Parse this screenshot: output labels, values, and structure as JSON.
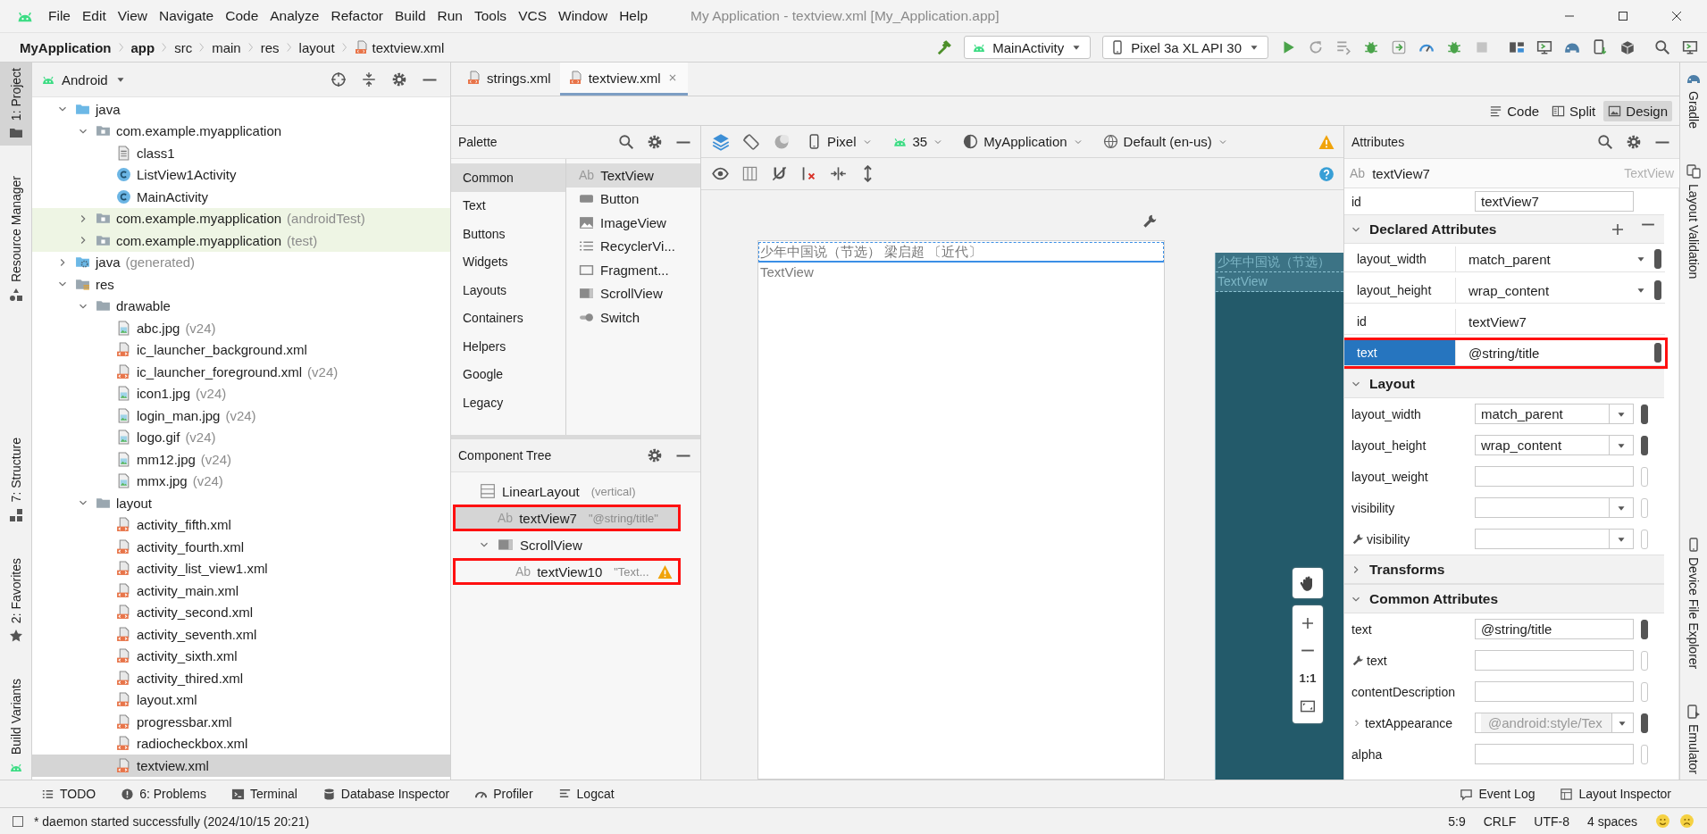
{
  "menu_bar": {
    "menus": [
      "File",
      "Edit",
      "View",
      "Navigate",
      "Code",
      "Analyze",
      "Refactor",
      "Build",
      "Run",
      "Tools",
      "VCS",
      "Window",
      "Help"
    ],
    "title": "My Application - textview.xml [My_Application.app]"
  },
  "breadcrumb": [
    {
      "label": "MyApplication",
      "kind": "module"
    },
    {
      "label": "app",
      "kind": "module"
    },
    {
      "label": "src",
      "kind": "folder"
    },
    {
      "label": "main",
      "kind": "folder"
    },
    {
      "label": "res",
      "kind": "folder"
    },
    {
      "label": "layout",
      "kind": "folder"
    },
    {
      "label": "textview.xml",
      "kind": "file"
    }
  ],
  "run_toolbar": {
    "configuration": "MainActivity",
    "device": "Pixel 3a XL API 30"
  },
  "left_strip": {
    "top": [
      {
        "label": "1: Project",
        "kind": "project",
        "selected": true
      },
      {
        "label": "Resource Manager",
        "kind": "resources",
        "selected": false
      }
    ],
    "bottom": [
      {
        "label": "7: Structure",
        "kind": "structure",
        "selected": false
      },
      {
        "label": "2: Favorites",
        "kind": "favorites",
        "selected": false
      },
      {
        "label": "Build Variants",
        "kind": "variants",
        "selected": false
      }
    ]
  },
  "project_panel": {
    "view": "Android",
    "tree": [
      {
        "label": "java",
        "kind": "source-folder",
        "expanded": true,
        "selected": false,
        "children": [
          {
            "label": "com.example.myapplication",
            "kind": "package",
            "expanded": true,
            "selected": false,
            "children": [
              {
                "label": "class1",
                "kind": "text-file",
                "selected": false
              },
              {
                "label": "ListView1Activity",
                "kind": "class",
                "selected": false
              },
              {
                "label": "MainActivity",
                "kind": "class",
                "selected": false
              }
            ]
          },
          {
            "label": "com.example.myapplication",
            "note": "(androidTest)",
            "kind": "test-package",
            "expanded": false,
            "selected": false
          },
          {
            "label": "com.example.myapplication",
            "note": "(test)",
            "kind": "test-package",
            "expanded": false,
            "selected": false
          }
        ]
      },
      {
        "label": "java",
        "note": "(generated)",
        "kind": "generated-folder",
        "expanded": false,
        "selected": false
      },
      {
        "label": "res",
        "kind": "res-folder",
        "expanded": true,
        "selected": false,
        "children": [
          {
            "label": "drawable",
            "kind": "folder",
            "expanded": true,
            "selected": false,
            "children": [
              {
                "label": "abc.jpg",
                "note": "(v24)",
                "kind": "image-file",
                "selected": false
              },
              {
                "label": "ic_launcher_background.xml",
                "kind": "xml-file",
                "selected": false
              },
              {
                "label": "ic_launcher_foreground.xml",
                "note": "(v24)",
                "kind": "xml-file",
                "selected": false
              },
              {
                "label": "icon1.jpg",
                "note": "(v24)",
                "kind": "image-file",
                "selected": false
              },
              {
                "label": "login_man.jpg",
                "note": "(v24)",
                "kind": "image-file",
                "selected": false
              },
              {
                "label": "logo.gif",
                "note": "(v24)",
                "kind": "image-file",
                "selected": false
              },
              {
                "label": "mm12.jpg",
                "note": "(v24)",
                "kind": "image-file",
                "selected": false
              },
              {
                "label": "mmx.jpg",
                "note": "(v24)",
                "kind": "image-file",
                "selected": false
              }
            ]
          },
          {
            "label": "layout",
            "kind": "folder",
            "expanded": true,
            "selected": false,
            "children": [
              {
                "label": "activity_fifth.xml",
                "kind": "xml-file",
                "selected": false
              },
              {
                "label": "activity_fourth.xml",
                "kind": "xml-file",
                "selected": false
              },
              {
                "label": "activity_list_view1.xml",
                "kind": "xml-file",
                "selected": false
              },
              {
                "label": "activity_main.xml",
                "kind": "xml-file",
                "selected": false
              },
              {
                "label": "activity_second.xml",
                "kind": "xml-file",
                "selected": false
              },
              {
                "label": "activity_seventh.xml",
                "kind": "xml-file",
                "selected": false
              },
              {
                "label": "activity_sixth.xml",
                "kind": "xml-file",
                "selected": false
              },
              {
                "label": "activity_thired.xml",
                "kind": "xml-file",
                "selected": false
              },
              {
                "label": "layout.xml",
                "kind": "xml-file",
                "selected": false
              },
              {
                "label": "progressbar.xml",
                "kind": "xml-file",
                "selected": false
              },
              {
                "label": "radiocheckbox.xml",
                "kind": "xml-file",
                "selected": false
              },
              {
                "label": "textview.xml",
                "kind": "xml-file",
                "selected": true
              }
            ]
          }
        ]
      }
    ]
  },
  "editor_tabs": [
    {
      "label": "strings.xml",
      "selected": false
    },
    {
      "label": "textview.xml",
      "selected": true
    }
  ],
  "view_modes": [
    {
      "label": "Code",
      "kind": "code",
      "selected": false
    },
    {
      "label": "Split",
      "kind": "split",
      "selected": false
    },
    {
      "label": "Design",
      "kind": "design",
      "selected": true
    }
  ],
  "palette": {
    "title": "Palette",
    "categories": [
      {
        "label": "Common",
        "selected": true
      },
      {
        "label": "Text",
        "selected": false
      },
      {
        "label": "Buttons",
        "selected": false
      },
      {
        "label": "Widgets",
        "selected": false
      },
      {
        "label": "Layouts",
        "selected": false
      },
      {
        "label": "Containers",
        "selected": false
      },
      {
        "label": "Helpers",
        "selected": false
      },
      {
        "label": "Google",
        "selected": false
      },
      {
        "label": "Legacy",
        "selected": false
      }
    ],
    "items": [
      {
        "label": "TextView",
        "kind": "textview",
        "badge": "Ab",
        "selected": true
      },
      {
        "label": "Button",
        "kind": "button",
        "selected": false
      },
      {
        "label": "ImageView",
        "kind": "imageview",
        "selected": false
      },
      {
        "label": "RecyclerVi...",
        "kind": "recycler",
        "selected": false
      },
      {
        "label": "Fragment...",
        "kind": "fragment",
        "selected": false
      },
      {
        "label": "ScrollView",
        "kind": "scrollview",
        "selected": false
      },
      {
        "label": "Switch",
        "kind": "switch",
        "selected": false
      }
    ]
  },
  "component_tree": {
    "title": "Component Tree",
    "tree": [
      {
        "name": "LinearLayout",
        "detail": "(vertical)",
        "kind": "linear",
        "selected": false,
        "children": [
          {
            "name": "textView7",
            "badge": "Ab",
            "detail": "\"@string/title\"",
            "kind": "textview",
            "selected": true,
            "annotated": true
          },
          {
            "name": "ScrollView",
            "kind": "scrollview",
            "expanded": true,
            "selected": false,
            "children": [
              {
                "name": "textView10",
                "badge": "Ab",
                "detail": "\"Text...",
                "kind": "textview",
                "warning": true,
                "selected": false,
                "annotated": true
              }
            ]
          }
        ]
      }
    ]
  },
  "design_toolbar": {
    "device": "Pixel",
    "api": "35",
    "theme": "MyApplication",
    "locale": "Default (en-us)"
  },
  "canvas": {
    "design_texts": [
      {
        "text": "少年中国说（节选） 梁启超 〔近代〕",
        "selected": true
      },
      {
        "text": "TextView",
        "selected": false
      }
    ],
    "blueprint_texts": [
      "少年中国说（节选）",
      "TextView"
    ],
    "zoom_label": "1:1"
  },
  "attributes": {
    "title": "Attributes",
    "component": {
      "badge": "Ab",
      "name": "textView7",
      "type": "TextView"
    },
    "id_row": {
      "name": "id",
      "value": "textView7"
    },
    "sections": [
      {
        "title": "Declared Attributes",
        "kind": "declared",
        "expanded": true,
        "rows": [
          {
            "name": "layout_width",
            "value": "match_parent",
            "kind": "dropdown",
            "selected": false
          },
          {
            "name": "layout_height",
            "value": "wrap_content",
            "kind": "dropdown",
            "selected": false
          },
          {
            "name": "id",
            "value": "textView7",
            "kind": "plain",
            "selected": false
          },
          {
            "name": "text",
            "value": "@string/title",
            "kind": "plain",
            "selected": true,
            "annotated": true
          }
        ]
      },
      {
        "title": "Layout",
        "kind": "form",
        "expanded": true,
        "rows": [
          {
            "name": "layout_width",
            "value": "match_parent",
            "kind": "dropdown"
          },
          {
            "name": "layout_height",
            "value": "wrap_content",
            "kind": "dropdown"
          },
          {
            "name": "layout_weight",
            "kind": "field"
          },
          {
            "name": "visibility",
            "kind": "dropdown"
          },
          {
            "name": "visibility",
            "kind": "dropdown",
            "tools": true
          }
        ]
      },
      {
        "title": "Transforms",
        "kind": "form",
        "expanded": false
      },
      {
        "title": "Common Attributes",
        "kind": "form",
        "expanded": true,
        "rows": [
          {
            "name": "text",
            "value": "@string/title",
            "kind": "field"
          },
          {
            "name": "text",
            "kind": "field",
            "tools": true
          },
          {
            "name": "contentDescription",
            "kind": "field"
          },
          {
            "name": "textAppearance",
            "placeholder": "@android:style/Tex",
            "kind": "dropdown",
            "expanded": false
          },
          {
            "name": "alpha",
            "kind": "field"
          }
        ]
      }
    ]
  },
  "right_strip": {
    "top": [
      {
        "label": "Gradle",
        "kind": "gradle"
      },
      {
        "label": "Layout Validation",
        "kind": "validation"
      }
    ],
    "bottom": [
      {
        "label": "Device File Explorer",
        "kind": "explorer"
      },
      {
        "label": "Emulator",
        "kind": "emulator"
      }
    ]
  },
  "tool_windows": [
    {
      "label": "TODO",
      "kind": "todo"
    },
    {
      "label": "6: Problems",
      "kind": "problems"
    },
    {
      "label": "Terminal",
      "kind": "terminal"
    },
    {
      "label": "Database Inspector",
      "kind": "database"
    },
    {
      "label": "Profiler",
      "kind": "profiler"
    },
    {
      "label": "Logcat",
      "kind": "logcat"
    }
  ],
  "tool_windows_right": [
    {
      "label": "Event Log",
      "kind": "eventlog"
    },
    {
      "label": "Layout Inspector",
      "kind": "inspector"
    }
  ],
  "status_bar": {
    "message": "* daemon started successfully (2024/10/15 20:21)",
    "items": [
      "5:9",
      "CRLF",
      "UTF-8",
      "4 spaces"
    ]
  }
}
